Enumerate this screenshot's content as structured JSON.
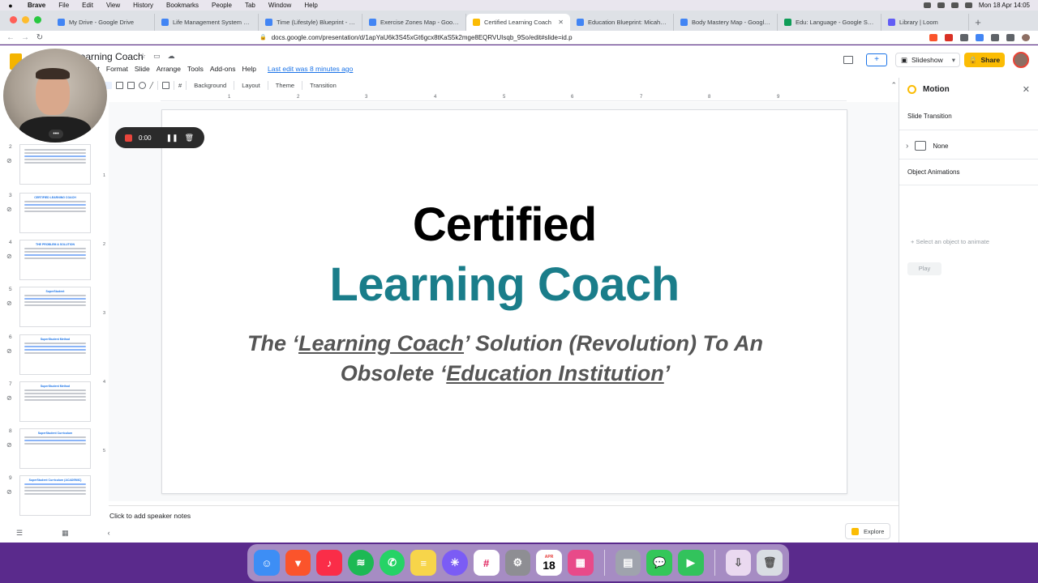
{
  "menubar": {
    "apple": "",
    "items": [
      "Brave",
      "File",
      "Edit",
      "View",
      "History",
      "Bookmarks",
      "People",
      "Tab",
      "Window",
      "Help"
    ],
    "clock": "Mon 18 Apr 14:05"
  },
  "browser": {
    "tabs": [
      {
        "title": "My Drive - Google Drive",
        "color": "#4285f4"
      },
      {
        "title": "Life Management System - Goog",
        "color": "#4285f4"
      },
      {
        "title": "Time (Lifestyle) Blueprint - Goog",
        "color": "#4285f4"
      },
      {
        "title": "Exercise Zones Map - Google Do",
        "color": "#4285f4"
      },
      {
        "title": "Certified Learning Coach",
        "color": "#fbbc04",
        "active": true
      },
      {
        "title": "Education Blueprint: Micah - Goo",
        "color": "#4285f4"
      },
      {
        "title": "Body Mastery Map - Google Docs",
        "color": "#4285f4"
      },
      {
        "title": "Edu: Language - Google Sheets",
        "color": "#0f9d58"
      },
      {
        "title": "Library | Loom",
        "color": "#625df5"
      }
    ],
    "new_tab": "+",
    "url": "docs.google.com/presentation/d/1apYaU6k3S45xGt6gcx8tKaS5k2mge8EQRVUIsqb_9So/edit#slide=id.p"
  },
  "app": {
    "doc_title": "Learning Coach",
    "menu": [
      "nsert",
      "Format",
      "Slide",
      "Arrange",
      "Tools",
      "Add-ons",
      "Help"
    ],
    "last_edit": "Last edit was 8 minutes ago",
    "slideshow_label": "Slideshow",
    "share_label": "Share",
    "toolbar": {
      "background": "Background",
      "layout": "Layout",
      "theme": "Theme",
      "transition": "Transition"
    }
  },
  "ruler": {
    "top": [
      "1",
      "2",
      "3",
      "4",
      "5",
      "6",
      "7",
      "8",
      "9"
    ],
    "left": [
      "1",
      "2",
      "3",
      "4",
      "5"
    ]
  },
  "filmstrip": [
    {
      "num": "2",
      "title": ""
    },
    {
      "num": "3",
      "title": "CERTIFIED LEARNING COACH"
    },
    {
      "num": "4",
      "title": "THE PROBLEM & SOLUTION"
    },
    {
      "num": "5",
      "title": "SuperStudent"
    },
    {
      "num": "6",
      "title": "SuperStudent Method"
    },
    {
      "num": "7",
      "title": "SuperStudent Method"
    },
    {
      "num": "8",
      "title": "SuperStudent Curriculum"
    },
    {
      "num": "9",
      "title": "SuperStudent Curriculum (ACADEMIC)"
    }
  ],
  "slide": {
    "title_line1": "Certified",
    "title_line2": "Learning Coach",
    "sub_a": "The ‘",
    "sub_b": "Learning Coach",
    "sub_c": "’ Solution (Revolution) To An Obsolete ‘",
    "sub_d": "Education Institution",
    "sub_e": "’",
    "title_color": "#1a7d8a"
  },
  "notes_placeholder": "Click to add speaker notes",
  "explore_label": "Explore",
  "motion_panel": {
    "title": "Motion",
    "slide_transition": "Slide Transition",
    "transition_value": "None",
    "object_animations": "Object Animations",
    "add_hint": "+ Select an object to animate",
    "play": "Play"
  },
  "recorder": {
    "time": "0:00",
    "more": "•••"
  },
  "dock": [
    {
      "name": "finder",
      "color": "#3d8ef5"
    },
    {
      "name": "brave",
      "color": "#fb542b"
    },
    {
      "name": "music",
      "color": "#fa2d48"
    },
    {
      "name": "spotify",
      "color": "#1db954"
    },
    {
      "name": "whatsapp",
      "color": "#25d366"
    },
    {
      "name": "notes",
      "color": "#f7d54a"
    },
    {
      "name": "loom-app",
      "color": "#7b5cf5"
    },
    {
      "name": "slack",
      "color": "#ffffff"
    },
    {
      "name": "system-preferences",
      "color": "#8e8e93"
    },
    {
      "name": "calendar",
      "color": "#ffffff",
      "day": "18",
      "month": "APR"
    },
    {
      "name": "launchpad",
      "color": "#e84a89"
    },
    {
      "name": "preview",
      "color": "#9fa3ad"
    },
    {
      "name": "messages",
      "color": "#34c759"
    },
    {
      "name": "facetime",
      "color": "#32c35c"
    },
    {
      "name": "downloads",
      "color": "#ead9f0"
    },
    {
      "name": "trash",
      "color": "#d9dde3"
    }
  ]
}
